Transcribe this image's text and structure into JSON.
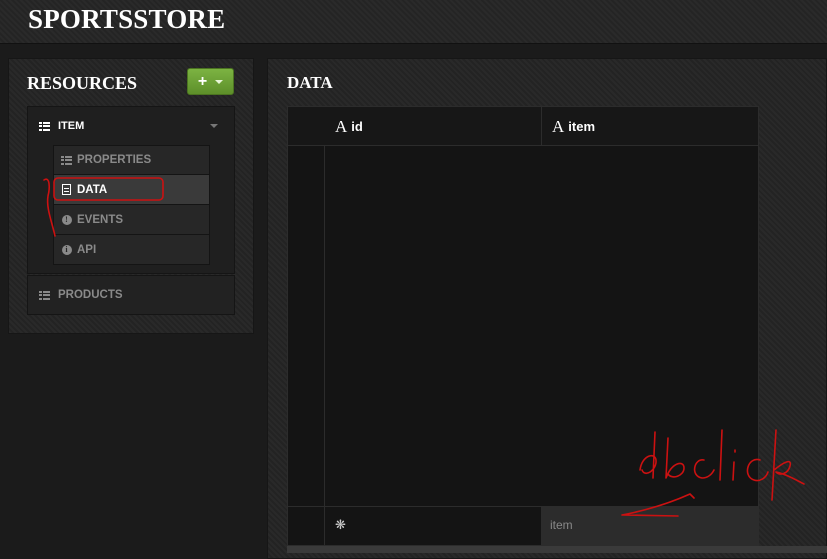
{
  "app": {
    "title": "SPORTSSTORE"
  },
  "resources": {
    "title": "RESOURCES",
    "add_label": "+",
    "groups": [
      {
        "label": "ITEM",
        "expanded": true,
        "children": [
          {
            "label": "PROPERTIES",
            "icon": "list-icon"
          },
          {
            "label": "DATA",
            "icon": "document-icon",
            "active": true
          },
          {
            "label": "EVENTS",
            "icon": "exclamation-circle-icon"
          },
          {
            "label": "API",
            "icon": "info-circle-icon"
          }
        ]
      },
      {
        "label": "PRODUCTS",
        "expanded": false
      }
    ]
  },
  "data_view": {
    "title": "DATA",
    "columns": [
      {
        "type_glyph": "A",
        "label": "id"
      },
      {
        "type_glyph": "A",
        "label": "item"
      }
    ],
    "rows": [],
    "new_row": {
      "marker": "❋",
      "item_placeholder": "item"
    }
  },
  "annotation": {
    "text": "dbclick",
    "color": "#cc1111"
  },
  "colors": {
    "accent_green": "#6fa336",
    "background": "#1b1b1b"
  }
}
